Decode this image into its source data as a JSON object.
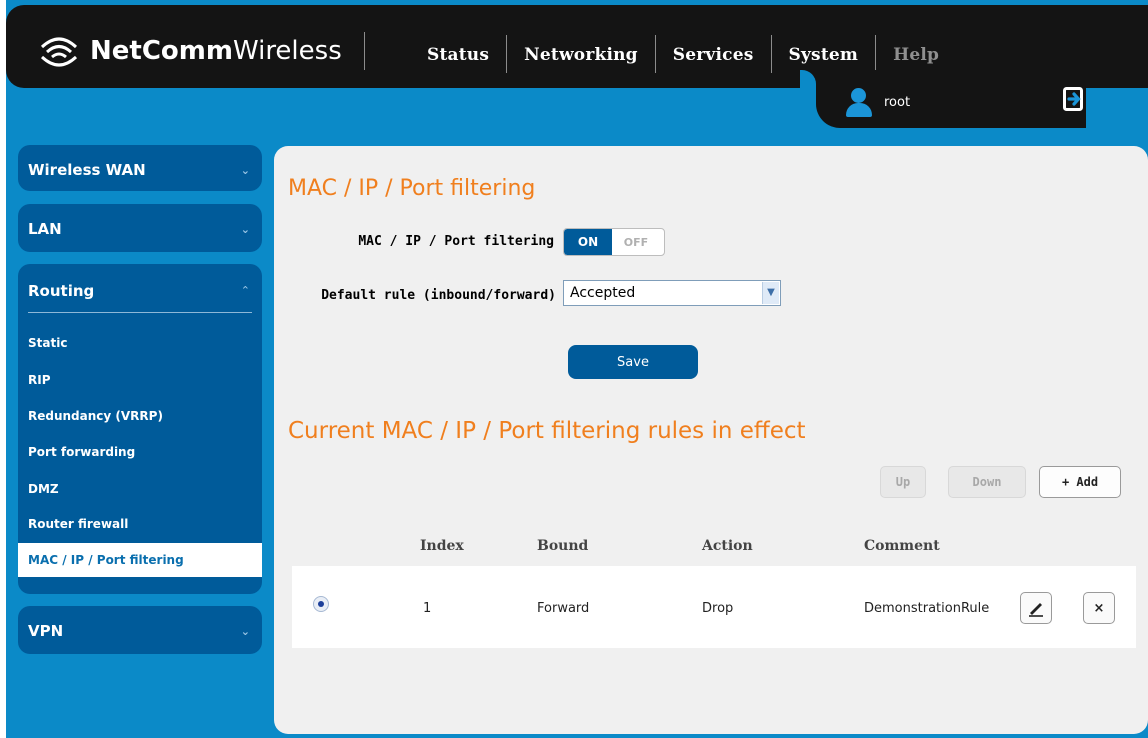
{
  "brand": {
    "name_bold": "NetComm",
    "name_light": "Wireless"
  },
  "nav": {
    "items": [
      {
        "label": "Status"
      },
      {
        "label": "Networking"
      },
      {
        "label": "Services"
      },
      {
        "label": "System"
      },
      {
        "label": "Help"
      }
    ]
  },
  "user": {
    "name": "root",
    "icon": "user-icon",
    "logout_icon": "logout-icon"
  },
  "sidebar": {
    "wireless_wan": "Wireless WAN",
    "lan": "LAN",
    "routing": "Routing",
    "vpn": "VPN",
    "routing_items": [
      "Static",
      "RIP",
      "Redundancy (VRRP)",
      "Port forwarding",
      "DMZ",
      "Router firewall",
      "MAC / IP / Port filtering"
    ]
  },
  "main": {
    "title": "MAC / IP / Port filtering",
    "filter_label": "MAC / IP / Port filtering",
    "toggle_on": "ON",
    "toggle_off": "OFF",
    "default_rule_label": "Default rule (inbound/forward)",
    "default_rule_value": "Accepted",
    "save_label": "Save",
    "rules_title": "Current MAC / IP / Port filtering rules in effect",
    "up_label": "Up",
    "down_label": "Down",
    "add_label": "+ Add",
    "columns": [
      "Index",
      "Bound",
      "Action",
      "Comment"
    ],
    "rows": [
      {
        "index": "1",
        "bound": "Forward",
        "action": "Drop",
        "comment": "DemonstrationRule"
      }
    ],
    "delete_glyph": "×"
  },
  "colors": {
    "accent": "#005b9a",
    "frame": "#0b8ac8",
    "heading": "#f07f1e",
    "header_bg": "#141414"
  }
}
